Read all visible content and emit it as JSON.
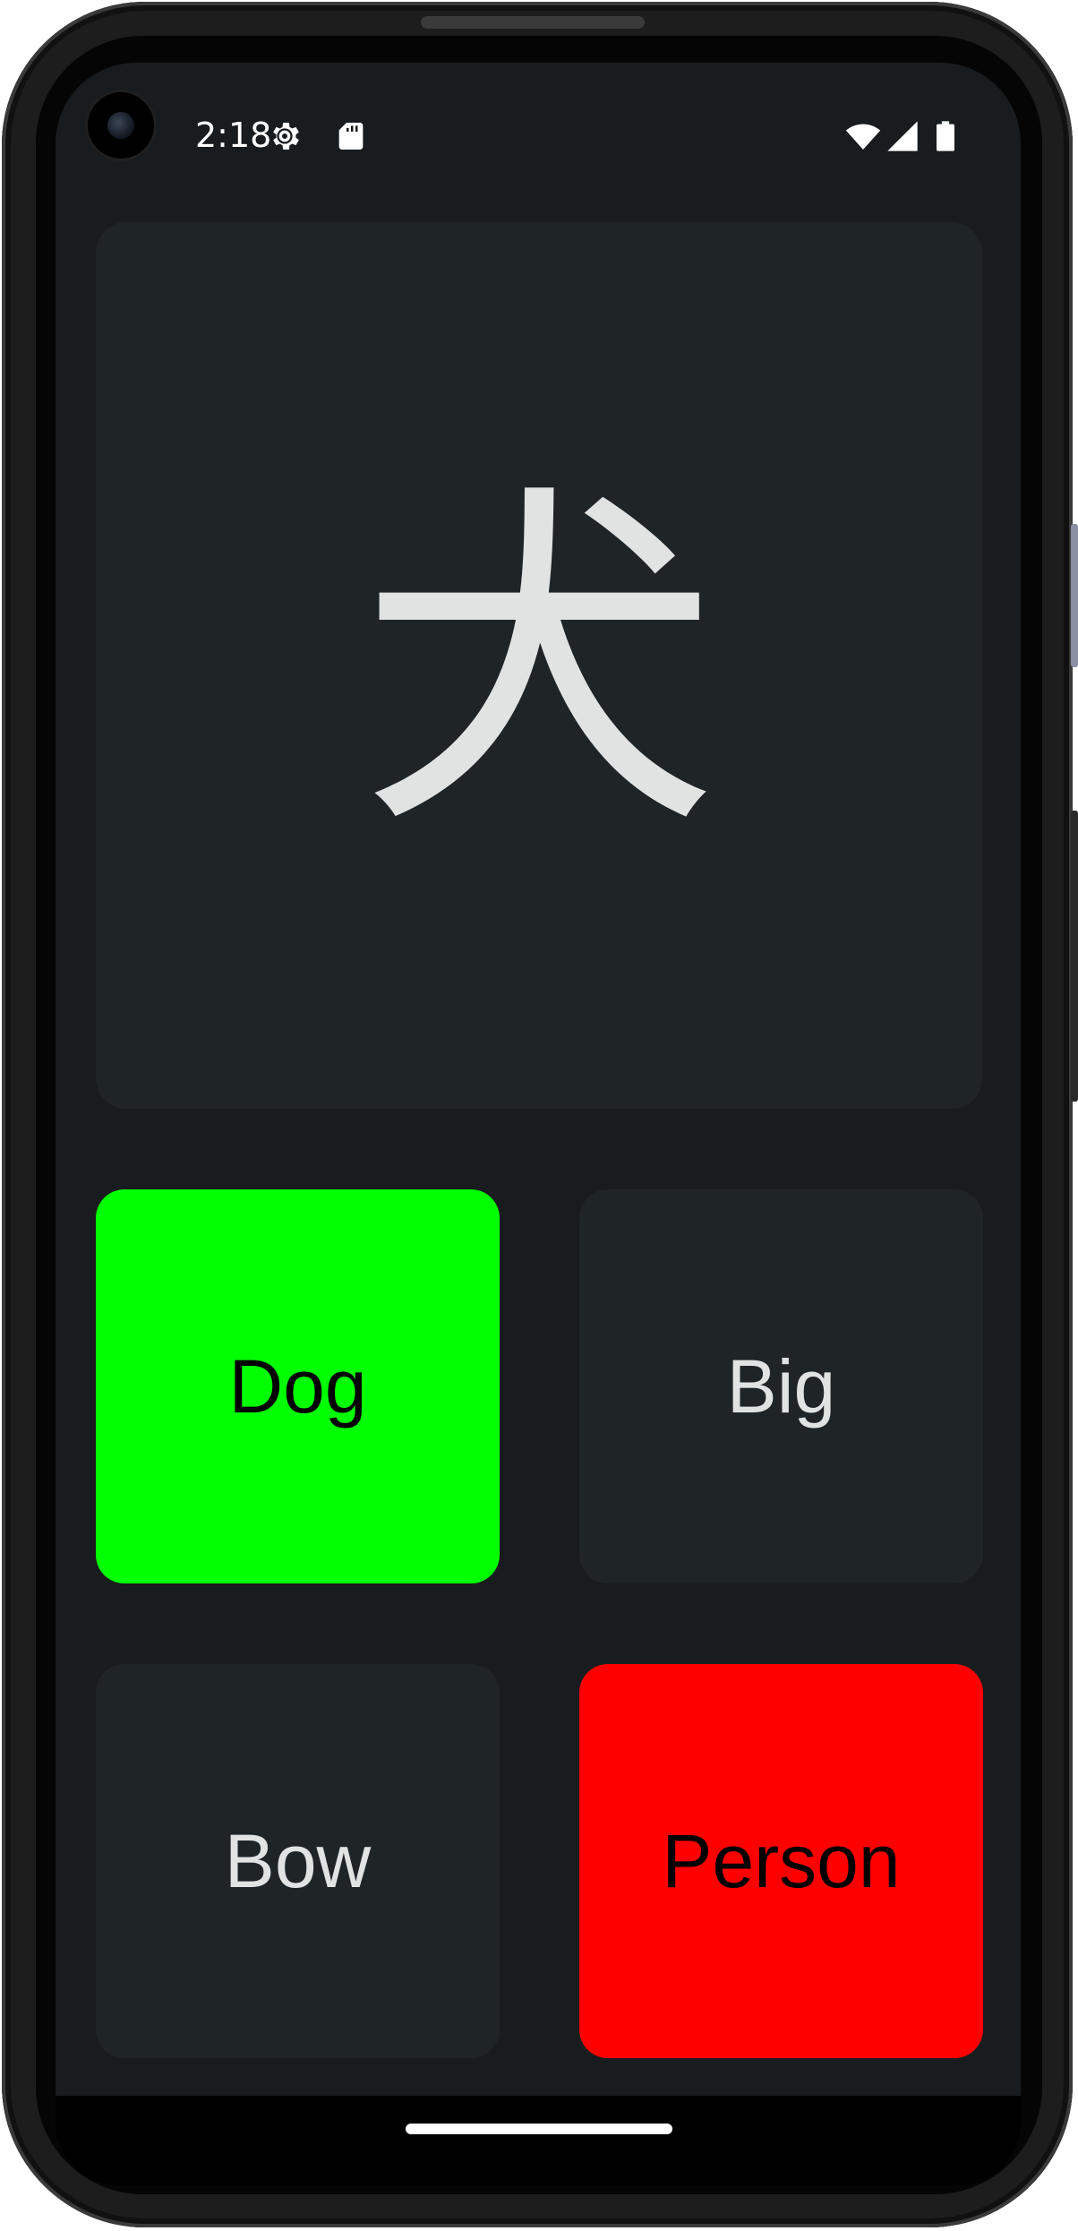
{
  "status_bar": {
    "time": "2:18",
    "icons": [
      "settings-gear-icon",
      "sd-card-icon",
      "wifi-icon",
      "cell-signal-icon",
      "battery-icon"
    ]
  },
  "quiz": {
    "prompt": "犬",
    "answers": [
      {
        "label": "Dog",
        "state": "correct",
        "background": "#00ff00",
        "text_color": "#000000"
      },
      {
        "label": "Big",
        "state": "neutral",
        "background": "#1f2427",
        "text_color": "#e1e3e3"
      },
      {
        "label": "Bow",
        "state": "neutral",
        "background": "#1f2427",
        "text_color": "#e1e3e3"
      },
      {
        "label": "Person",
        "state": "incorrect",
        "background": "#ff0000",
        "text_color": "#000000"
      }
    ]
  },
  "colors": {
    "screen_background": "#191c1e",
    "card_background": "#1f2427",
    "text": "#e1e3e3",
    "correct": "#00ff00",
    "incorrect": "#ff0000"
  }
}
